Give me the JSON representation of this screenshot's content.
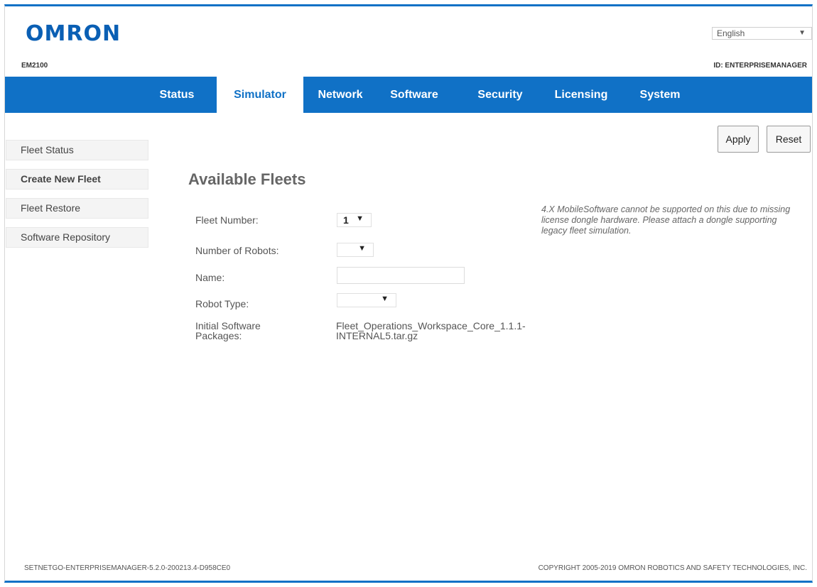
{
  "header": {
    "logo": "OMRON",
    "model": "EM2100",
    "language": "English",
    "device_id": "ID: ENTERPRISEMANAGER"
  },
  "nav": {
    "tabs": [
      "Status",
      "Simulator",
      "Network",
      "Software",
      "Security",
      "Licensing",
      "System"
    ],
    "active": "Simulator"
  },
  "sidebar": {
    "items": [
      "Fleet Status",
      "Create New Fleet",
      "Fleet Restore",
      "Software Repository"
    ]
  },
  "actions": {
    "apply": "Apply",
    "reset": "Reset"
  },
  "main": {
    "title": "Available Fleets",
    "fields": {
      "fleet_number_label": "Fleet Number:",
      "fleet_number_value": "1",
      "robots_label": "Number of Robots:",
      "robots_value": "",
      "name_label": "Name:",
      "name_value": "",
      "robot_type_label": "Robot Type:",
      "robot_type_value": "",
      "packages_label": "Initial Software Packages:",
      "packages_value": "Fleet_Operations_Workspace_Core_1.1.1-INTERNAL5.tar.gz"
    },
    "notice": "4.X MobileSoftware cannot be supported on this due to missing license dongle hardware. Please attach a dongle supporting legacy fleet simulation."
  },
  "footer": {
    "version": "SETNETGO-ENTERPRISEMANAGER-5.2.0-200213.4-D958CE0",
    "copyright": "COPYRIGHT 2005-2019 OMRON ROBOTICS AND SAFETY TECHNOLOGIES, INC."
  },
  "colors": {
    "brand": "#1071c6",
    "logo": "#0a5fb4"
  }
}
